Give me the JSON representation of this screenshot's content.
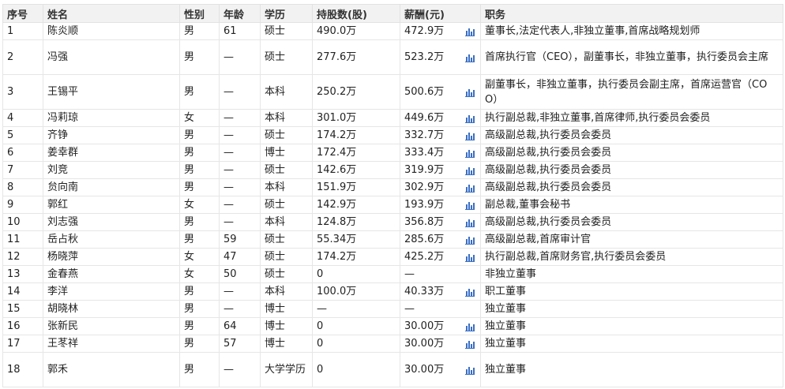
{
  "headers": {
    "no": "序号",
    "name": "姓名",
    "gender": "性别",
    "age": "年龄",
    "education": "学历",
    "shares": "持股数(股)",
    "salary": "薪酬(元)",
    "duty": "职务"
  },
  "colors": {
    "header_bg": "#f2f2f2",
    "border": "#e6e6e6",
    "icon": "#3a6fc4"
  },
  "rows": [
    {
      "no": "1",
      "name": "陈炎顺",
      "gender": "男",
      "age": "61",
      "education": "硕士",
      "shares": "490.0万",
      "salary": "472.9万",
      "chart": true,
      "duty": "董事长,法定代表人,非独立董事,首席战略规划师",
      "tall": false
    },
    {
      "no": "2",
      "name": "冯强",
      "gender": "男",
      "age": "—",
      "education": "硕士",
      "shares": "277.6万",
      "salary": "523.2万",
      "chart": true,
      "duty": "首席执行官（CEO），副董事长，非独立董事，执行委员会主席",
      "tall": true
    },
    {
      "no": "3",
      "name": "王锡平",
      "gender": "男",
      "age": "—",
      "education": "本科",
      "shares": "250.2万",
      "salary": "500.6万",
      "chart": true,
      "duty": "副董事长，非独立董事，执行委员会副主席，首席运营官（COO）",
      "tall": true
    },
    {
      "no": "4",
      "name": "冯莉琼",
      "gender": "女",
      "age": "—",
      "education": "本科",
      "shares": "301.0万",
      "salary": "449.6万",
      "chart": true,
      "duty": "执行副总裁,非独立董事,首席律师,执行委员会委员",
      "tall": false
    },
    {
      "no": "5",
      "name": "齐铮",
      "gender": "男",
      "age": "—",
      "education": "硕士",
      "shares": "174.2万",
      "salary": "332.7万",
      "chart": true,
      "duty": "高级副总裁,执行委员会委员",
      "tall": false
    },
    {
      "no": "6",
      "name": "姜幸群",
      "gender": "男",
      "age": "—",
      "education": "博士",
      "shares": "172.4万",
      "salary": "333.4万",
      "chart": true,
      "duty": "高级副总裁,执行委员会委员",
      "tall": false
    },
    {
      "no": "7",
      "name": "刘竞",
      "gender": "男",
      "age": "—",
      "education": "硕士",
      "shares": "142.6万",
      "salary": "319.9万",
      "chart": true,
      "duty": "高级副总裁,执行委员会委员",
      "tall": false
    },
    {
      "no": "8",
      "name": "贠向南",
      "gender": "男",
      "age": "—",
      "education": "本科",
      "shares": "151.9万",
      "salary": "302.9万",
      "chart": true,
      "duty": "高级副总裁,执行委员会委员",
      "tall": false
    },
    {
      "no": "9",
      "name": "郭红",
      "gender": "女",
      "age": "—",
      "education": "硕士",
      "shares": "142.9万",
      "salary": "193.9万",
      "chart": true,
      "duty": "副总裁,董事会秘书",
      "tall": false
    },
    {
      "no": "10",
      "name": "刘志强",
      "gender": "男",
      "age": "—",
      "education": "本科",
      "shares": "124.8万",
      "salary": "356.8万",
      "chart": true,
      "duty": "高级副总裁,执行委员会委员",
      "tall": false
    },
    {
      "no": "11",
      "name": "岳占秋",
      "gender": "男",
      "age": "59",
      "education": "硕士",
      "shares": "55.34万",
      "salary": "285.6万",
      "chart": true,
      "duty": "高级副总裁,首席审计官",
      "tall": false
    },
    {
      "no": "12",
      "name": "杨晓萍",
      "gender": "女",
      "age": "47",
      "education": "硕士",
      "shares": "174.2万",
      "salary": "425.2万",
      "chart": true,
      "duty": "执行副总裁,首席财务官,执行委员会委员",
      "tall": false
    },
    {
      "no": "13",
      "name": "金春燕",
      "gender": "女",
      "age": "50",
      "education": "硕士",
      "shares": "0",
      "salary": "—",
      "chart": false,
      "duty": "非独立董事",
      "tall": false
    },
    {
      "no": "14",
      "name": "李洋",
      "gender": "男",
      "age": "—",
      "education": "本科",
      "shares": "100.0万",
      "salary": "40.33万",
      "chart": true,
      "duty": "职工董事",
      "tall": false
    },
    {
      "no": "15",
      "name": "胡晓林",
      "gender": "男",
      "age": "—",
      "education": "博士",
      "shares": "—",
      "salary": "—",
      "chart": false,
      "duty": "独立董事",
      "tall": false
    },
    {
      "no": "16",
      "name": "张新民",
      "gender": "男",
      "age": "64",
      "education": "博士",
      "shares": "0",
      "salary": "30.00万",
      "chart": true,
      "duty": "独立董事",
      "tall": false
    },
    {
      "no": "17",
      "name": "王苳祥",
      "gender": "男",
      "age": "57",
      "education": "博士",
      "shares": "0",
      "salary": "30.00万",
      "chart": true,
      "duty": "独立董事",
      "tall": false
    },
    {
      "no": "18",
      "name": "郭禾",
      "gender": "男",
      "age": "—",
      "education": "大学学历",
      "shares": "0",
      "salary": "30.00万",
      "chart": true,
      "duty": "独立董事",
      "tall": true
    }
  ]
}
